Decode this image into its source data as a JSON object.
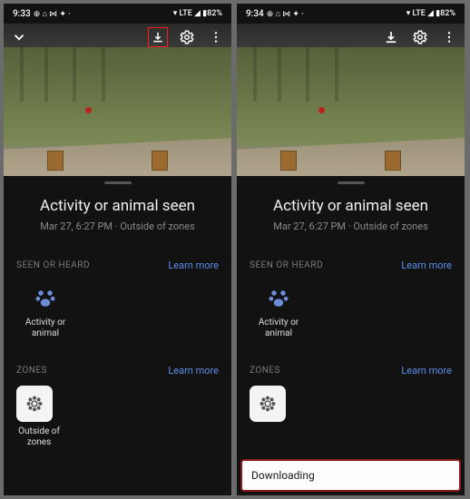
{
  "left": {
    "status": {
      "time": "9:33",
      "icons": "⊕ ⌂ ⋈ ✦ ·",
      "net": "▾ LTE ◢ ▮82%"
    },
    "event": {
      "title": "Activity or animal seen",
      "subtitle": "Mar 27, 6:27 PM · Outside of zones"
    },
    "sect_seen": "SEEN OR HEARD",
    "sect_zones": "ZONES",
    "learn": "Learn more",
    "tile_activity": "Activity or animal",
    "tile_zone": "Outside of zones"
  },
  "right": {
    "status": {
      "time": "9:34",
      "icons": "⊕ ⌂ ⋈ ✦ ·",
      "net": "▾ LTE ◢ ▮82%"
    },
    "event": {
      "title": "Activity or animal seen",
      "subtitle": "Mar 27, 6:27 PM · Outside of zones"
    },
    "sect_seen": "SEEN OR HEARD",
    "sect_zones": "ZONES",
    "learn": "Learn more",
    "tile_activity": "Activity or animal",
    "toast": "Downloading"
  }
}
